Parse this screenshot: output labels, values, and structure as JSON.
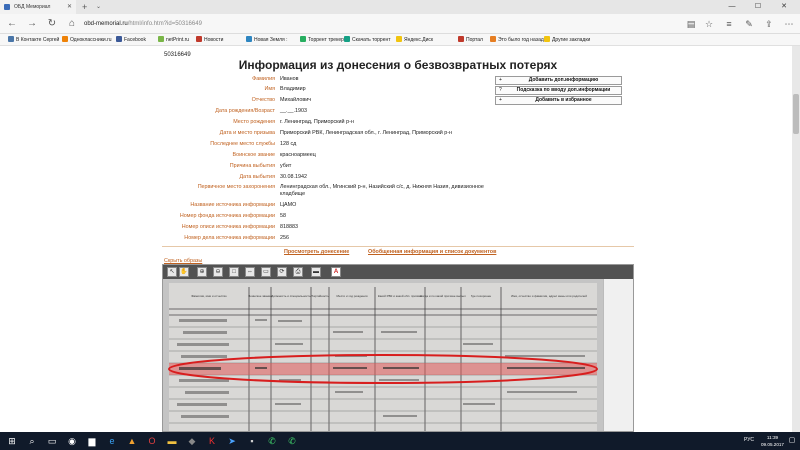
{
  "browser": {
    "tab_title": "ОБД Мемориал",
    "url_host": "obd-memorial.ru",
    "url_path": "/html/info.htm?id=50316649",
    "bookmarks": [
      {
        "label": "В Контакте Сергей",
        "color": "#4a76a8"
      },
      {
        "label": "Одноклассники.ru",
        "color": "#ee8208"
      },
      {
        "label": "Facebook",
        "color": "#3b5998"
      },
      {
        "label": "netPrint.ru",
        "color": "#7ab648"
      },
      {
        "label": "Новости",
        "color": "#c0392b"
      },
      {
        "label": "Новая Земля :",
        "color": "#2e86c1"
      },
      {
        "label": "Торрент трекер",
        "color": "#27ae60"
      },
      {
        "label": "Скачать торрент",
        "color": "#16a085"
      },
      {
        "label": "Яндекс.Диск",
        "color": "#f1c40f"
      },
      {
        "label": "Портал",
        "color": "#c0392b"
      },
      {
        "label": "Это было год назад",
        "color": "#e67e22"
      },
      {
        "label": "Другие закладки",
        "color": "#f1c40f"
      }
    ]
  },
  "page": {
    "record_id": "50316649",
    "title": "Информация из донесения о безвозвратных потерях",
    "fields": [
      {
        "label": "Фамилия",
        "value": "Иванов"
      },
      {
        "label": "Имя",
        "value": "Владимир"
      },
      {
        "label": "Отчество",
        "value": "Михайлович"
      },
      {
        "label": "Дата рождения/Возраст",
        "value": "__.__.1903"
      },
      {
        "label": "Место рождения",
        "value": "г. Ленинград, Приморский р-н"
      },
      {
        "label": "Дата и место призыва",
        "value": "Приморский РВК, Ленинградская обл., г. Ленинград, Приморский р-н"
      },
      {
        "label": "Последнее место службы",
        "value": "128 сд"
      },
      {
        "label": "Воинское звание",
        "value": "красноармеец"
      },
      {
        "label": "Причина выбытия",
        "value": "убит"
      },
      {
        "label": "Дата выбытия",
        "value": "30.08.1942"
      },
      {
        "label": "Первичное место захоронения",
        "value": "Ленинградская обл., Мгинский р-н, Назийский с/с, д. Нижняя Назия, дивизионное кладбище"
      },
      {
        "label": "Название источника информации",
        "value": "ЦАМО"
      },
      {
        "label": "Номер фонда источника информации",
        "value": "58"
      },
      {
        "label": "Номер описи источника информации",
        "value": "818883"
      },
      {
        "label": "Номер дела источника информации",
        "value": "256"
      }
    ],
    "actions": [
      {
        "prefix": "+",
        "label": "Добавить доп.информацию"
      },
      {
        "prefix": "?",
        "label": "Подсказка по вводу доп.информации"
      },
      {
        "prefix": "+",
        "label": "Добавить в избранное"
      }
    ],
    "links": {
      "view_report": "Просмотреть донесение",
      "summary": "Обобщенная информация и список документов"
    },
    "hide_images": "Скрыть образы"
  },
  "viewer": {
    "columns": [
      "Фамилия, имя и отчество",
      "Воинское звание",
      "Должность и специальность",
      "Партийность",
      "Место и год рождения",
      "Какой РВК и какой обл. призван",
      "Когда и по какой причине выбыл",
      "Где похоронен",
      "Имя, отчество и фамилия, адрес жены или родителей"
    ]
  },
  "taskbar": {
    "lang": "РУС",
    "time": "11:39",
    "date": "09.05.2017"
  }
}
